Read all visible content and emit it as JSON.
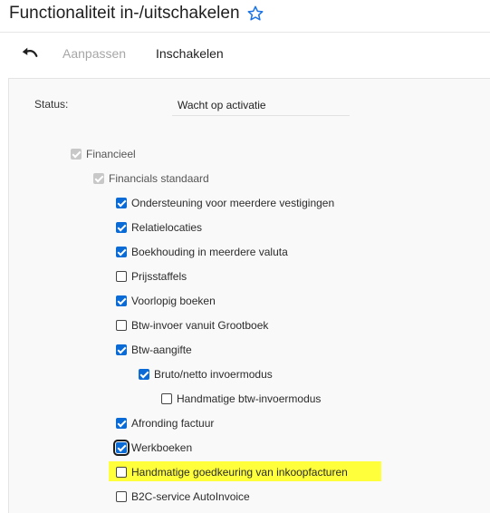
{
  "header": {
    "title": "Functionaliteit in-/uitschakelen"
  },
  "toolbar": {
    "adjust_label": "Aanpassen",
    "enable_label": "Inschakelen"
  },
  "status": {
    "label": "Status:",
    "value": "Wacht op activatie"
  },
  "tree": [
    {
      "label": "Financieel",
      "state": "disabled-checked"
    },
    {
      "label": "Financials standaard",
      "state": "disabled-checked"
    },
    {
      "label": "Ondersteuning voor meerdere vestigingen",
      "state": "checked"
    },
    {
      "label": "Relatielocaties",
      "state": "checked"
    },
    {
      "label": "Boekhouding in meerdere valuta",
      "state": "checked"
    },
    {
      "label": "Prijsstaffels",
      "state": "unchecked"
    },
    {
      "label": "Voorlopig boeken",
      "state": "checked"
    },
    {
      "label": "Btw-invoer vanuit Grootboek",
      "state": "unchecked"
    },
    {
      "label": "Btw-aangifte",
      "state": "checked"
    },
    {
      "label": "Bruto/netto invoermodus",
      "state": "checked"
    },
    {
      "label": "Handmatige btw-invoermodus",
      "state": "unchecked"
    },
    {
      "label": "Afronding factuur",
      "state": "checked"
    },
    {
      "label": "Werkboeken",
      "state": "checked-focused"
    },
    {
      "label": "Handmatige goedkeuring van inkoopfacturen",
      "state": "unchecked",
      "highlight_color": "#ffff3b"
    },
    {
      "label": "B2C-service AutoInvoice",
      "state": "unchecked"
    }
  ],
  "colors": {
    "checkbox_checked": "#0a6bd6",
    "checkbox_disabled": "#c8c8c8",
    "highlight": "#ffff3b",
    "star": "#1a73e8"
  },
  "icons": {
    "favorite": "star-outline-icon",
    "undo": "undo-icon"
  }
}
